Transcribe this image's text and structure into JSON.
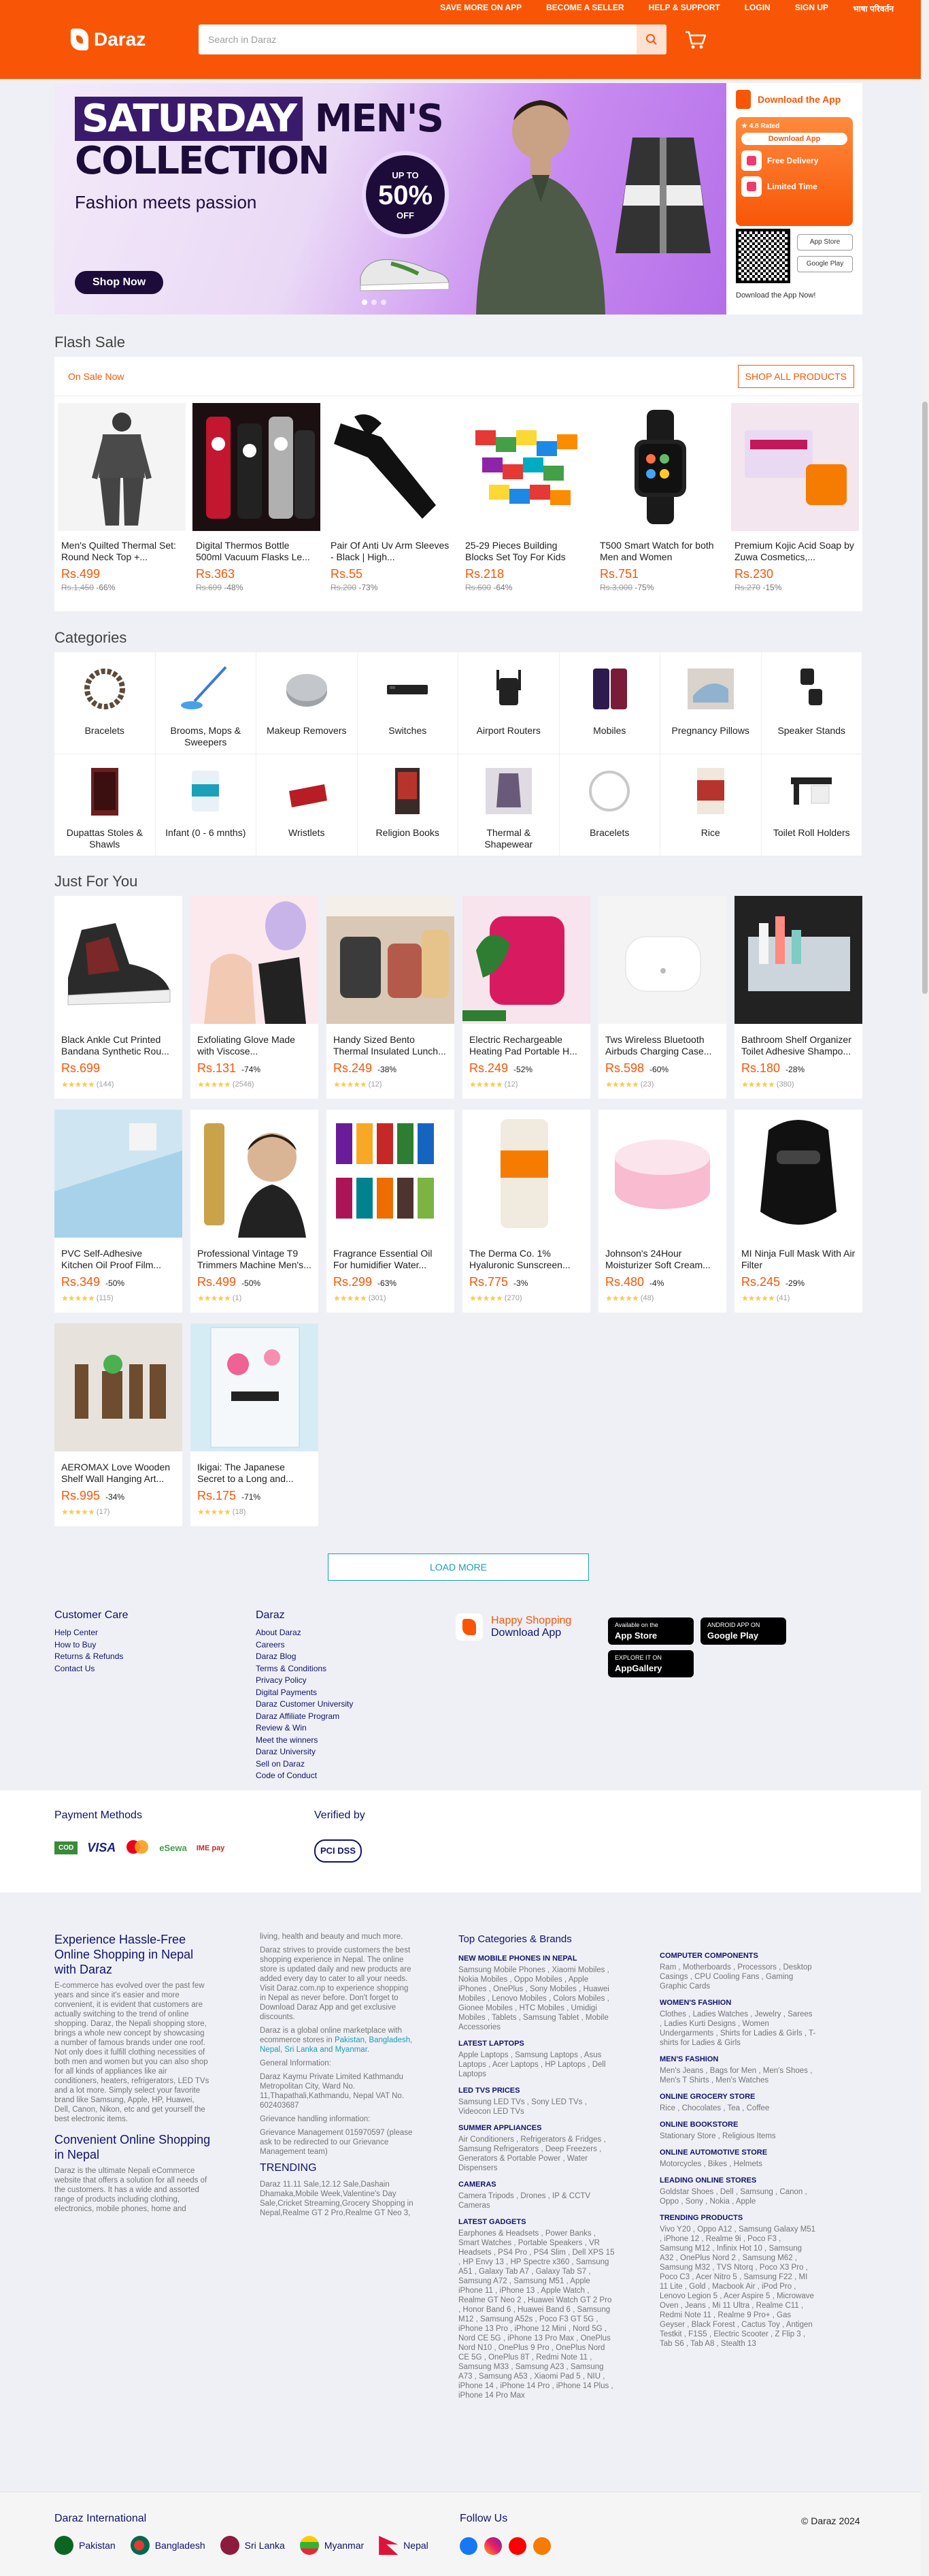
{
  "top_links": [
    "SAVE MORE ON APP",
    "BECOME A SELLER",
    "HELP & SUPPORT",
    "LOGIN",
    "SIGN UP",
    "भाषा परिवर्तन"
  ],
  "logo": "Daraz",
  "search": {
    "placeholder": "Search in Daraz"
  },
  "banner": {
    "title_line1": "SATURDAY",
    "title_line1b": "MEN'S",
    "title_line2": "COLLECTION",
    "subtitle": "Fashion meets passion",
    "button": "Shop Now",
    "badge_top": "UP TO",
    "badge_value": "50%",
    "badge_bottom": "OFF"
  },
  "app_card": {
    "title": "Download the App",
    "rated": "4.8 Rated",
    "download": "Download App",
    "feature1": "Free Delivery",
    "feature2": "Limited Time",
    "store1": "App Store",
    "store2": "Google Play",
    "caption": "Download the App Now!"
  },
  "flash_sale": {
    "title": "Flash Sale",
    "on_sale": "On Sale Now",
    "shop_all": "SHOP ALL PRODUCTS",
    "products": [
      {
        "name": "Men's Quilted Thermal Set: Round Neck Top +...",
        "price": "Rs.499",
        "old": "Rs.1,450",
        "disc": "-66%"
      },
      {
        "name": "Digital Thermos Bottle 500ml Vacuum Flasks Le...",
        "price": "Rs.363",
        "old": "Rs.699",
        "disc": "-48%"
      },
      {
        "name": "Pair Of Anti Uv Arm Sleeves - Black | High...",
        "price": "Rs.55",
        "old": "Rs.200",
        "disc": "-73%"
      },
      {
        "name": "25-29 Pieces Building Blocks Set Toy For Kids",
        "price": "Rs.218",
        "old": "Rs.600",
        "disc": "-64%"
      },
      {
        "name": "T500 Smart Watch for both Men and Women",
        "price": "Rs.751",
        "old": "Rs.3,000",
        "disc": "-75%"
      },
      {
        "name": "Premium Kojic Acid Soap by Zuwa Cosmetics,...",
        "price": "Rs.230",
        "old": "Rs.270",
        "disc": "-15%"
      }
    ]
  },
  "categories": {
    "title": "Categories",
    "items": [
      "Bracelets",
      "Brooms, Mops & Sweepers",
      "Makeup Removers",
      "Switches",
      "Airport Routers",
      "Mobiles",
      "Pregnancy Pillows",
      "Speaker Stands",
      "Dupattas Stoles & Shawls",
      "Infant (0 - 6 mnths)",
      "Wristlets",
      "Religion Books",
      "Thermal & Shapewear",
      "Bracelets",
      "Rice",
      "Toilet Roll Holders"
    ]
  },
  "just_for_you": {
    "title": "Just For You",
    "items": [
      {
        "name": "Black Ankle Cut Printed Bandana Synthetic Rou...",
        "price": "Rs.699",
        "disc": "",
        "reviews": "(144)"
      },
      {
        "name": "Exfoliating Glove Made with Viscose...",
        "price": "Rs.131",
        "disc": "-74%",
        "reviews": "(2546)"
      },
      {
        "name": "Handy Sized Bento Thermal Insulated Lunch...",
        "price": "Rs.249",
        "disc": "-38%",
        "reviews": "(12)"
      },
      {
        "name": "Electric Rechargeable Heating Pad Portable H...",
        "price": "Rs.249",
        "disc": "-52%",
        "reviews": "(12)"
      },
      {
        "name": "Tws Wireless Bluetooth Airbuds Charging Case...",
        "price": "Rs.598",
        "disc": "-60%",
        "reviews": "(23)"
      },
      {
        "name": "Bathroom Shelf Organizer Toilet Adhesive Shampo...",
        "price": "Rs.180",
        "disc": "-28%",
        "reviews": "(380)"
      },
      {
        "name": "PVC Self-Adhesive Kitchen Oil Proof Film...",
        "price": "Rs.349",
        "disc": "-50%",
        "reviews": "(115)"
      },
      {
        "name": "Professional Vintage T9 Trimmers Machine Men's...",
        "price": "Rs.499",
        "disc": "-50%",
        "reviews": "(1)"
      },
      {
        "name": "Fragrance Essential Oil For humidifier Water...",
        "price": "Rs.299",
        "disc": "-63%",
        "reviews": "(301)"
      },
      {
        "name": "The Derma Co. 1% Hyaluronic Sunscreen...",
        "price": "Rs.775",
        "disc": "-3%",
        "reviews": "(270)"
      },
      {
        "name": "Johnson's 24Hour Moisturizer Soft Cream...",
        "price": "Rs.480",
        "disc": "-4%",
        "reviews": "(48)"
      },
      {
        "name": "MI Ninja Full Mask With Air Filter",
        "price": "Rs.245",
        "disc": "-29%",
        "reviews": "(41)"
      },
      {
        "name": "AEROMAX Love Wooden Shelf Wall Hanging Art...",
        "price": "Rs.995",
        "disc": "-34%",
        "reviews": "(17)"
      },
      {
        "name": "Ikigai: The Japanese Secret to a Long and...",
        "price": "Rs.175",
        "disc": "-71%",
        "reviews": "(18)"
      }
    ],
    "load_more": "LOAD MORE"
  },
  "footer": {
    "customer_care": {
      "title": "Customer Care",
      "links": [
        "Help Center",
        "How to Buy",
        "Returns & Refunds",
        "Contact Us"
      ]
    },
    "daraz": {
      "title": "Daraz",
      "links": [
        "About Daraz",
        "Careers",
        "Daraz Blog",
        "Terms & Conditions",
        "Privacy Policy",
        "Digital Payments",
        "Daraz Customer University",
        "Daraz Affiliate Program",
        "Review & Win",
        "Meet the winners",
        "Daraz University",
        "Sell on Daraz",
        "Code of Conduct"
      ]
    },
    "happy_shopping": "Happy Shopping",
    "download_app": "Download App",
    "app_store_small": "Available on the",
    "app_store": "App Store",
    "google_play_small": "ANDROID APP ON",
    "google_play": "Google Play",
    "appgallery_small": "EXPLORE IT ON",
    "appgallery": "AppGallery"
  },
  "payment": {
    "title": "Payment Methods",
    "methods": [
      "COD",
      "VISA",
      "●●",
      "eSewa",
      "IME pay"
    ],
    "verified_title": "Verified by",
    "verified": "PCI DSS"
  },
  "seo": {
    "col1_title": "Experience Hassle-Free Online Shopping in Nepal with Daraz",
    "col1_text": "E-commerce has evolved over the past few years and since it's easier and more convenient, it is evident that customers are actually switching to the trend of online shopping. Daraz, the Nepali shopping store, brings a whole new concept by showcasing a number of famous brands under one roof. Not only does it fulfill clothing necessities of both men and women but you can also shop for all kinds of appliances like air conditioners, heaters, refrigerators, LED TVs and a lot more. Simply select your favorite brand like Samsung, Apple, HP, Huawei, Dell, Canon, Nikon, etc and get yourself the best electronic items.",
    "col1_title2": "Convenient Online Shopping in Nepal",
    "col1_text2": "Daraz is the ultimate Nepali eCommerce website that offers a solution for all needs of the customers. It has a wide and assorted range of products including clothing, electronics, mobile phones, home and",
    "col2_text1": "living, health and beauty and much more.",
    "col2_text2": "Daraz strives to provide customers the best shopping experience in Nepal. The online store is updated daily and new products are added every day to cater to all your needs. Visit Daraz.com.np to experience shopping in Nepal as never before. Don't forget to Download Daraz App and get exclusive discounts.",
    "col2_text3": "Daraz is a global online marketplace with ecommerce stores in",
    "col2_links": "Pakistan, Bangladesh, Nepal, Sri Lanka and Myanmar.",
    "col2_gi": "General Information:",
    "col2_addr": "Daraz Kaymu Private Limited Kathmandu Metropolitan City, Ward No. 11,Thapathali,Kathmandu, Nepal VAT No. 602403687",
    "col2_gh": "Grievance handling information:",
    "col2_gm": "Grievance Management 015970597 (please ask to be redirected to our Grievance Management team)",
    "col2_trending": "TRENDING",
    "col2_trend_text": "Daraz 11.11 Sale,12.12 Sale,Dashain Dhamaka,Mobile Week,Valentine's Day Sale,Cricket Streaming,Grocery Shopping in Nepal,Realme GT 2 Pro,Realme GT Neo 3,",
    "col3_title": "Top Categories & Brands",
    "col3_groups": [
      {
        "h": "NEW MOBILE PHONES IN NEPAL",
        "t": "Samsung Mobile Phones , Xiaomi Mobiles , Nokia Mobiles , Oppo Mobiles , Apple iPhones , OnePlus , Sony Mobiles , Huawei Mobiles , Lenovo Mobiles , Colors Mobiles , Gionee Mobiles , HTC Mobiles , Umidigi Mobiles , Tablets , Samsung Tablet , Mobile Accessories"
      },
      {
        "h": "LATEST LAPTOPS",
        "t": "Apple Laptops , Samsung Laptops , Asus Laptops , Acer Laptops , HP Laptops , Dell Laptops"
      },
      {
        "h": "LED TVS PRICES",
        "t": "Samsung LED TVs , Sony LED TVs , Videocon LED TVs"
      },
      {
        "h": "SUMMER APPLIANCES",
        "t": "Air Conditioners , Refrigerators & Fridges , Samsung Refrigerators , Deep Freezers , Generators & Portable Power , Water Dispensers"
      },
      {
        "h": "CAMERAS",
        "t": "Camera Tripods , Drones , IP & CCTV Cameras"
      },
      {
        "h": "LATEST GADGETS",
        "t": "Earphones & Headsets , Power Banks , Smart Watches , Portable Speakers , VR Headsets , PS4 Pro , PS4 Slim , Dell XPS 15 , HP Envy 13 , HP Spectre x360 , Samsung A51 , Galaxy Tab A7 , Galaxy Tab S7 , Samsung A72 , Samsung M51 , Apple iPhone 11 , iPhone 13 , Apple Watch , Realme GT Neo 2 , Huawei Watch GT 2 Pro , Honor Band 6 , Huawei Band 6 , Samsung M12 , Samsung A52s , Poco F3 GT 5G , iPhone 13 Pro , iPhone 12 Mini , Nord 5G , Nord CE 5G , iPhone 13 Pro Max , OnePlus Nord N10 , OnePlus 9 Pro , OnePlus Nord CE 5G , OnePlus 8T , Redmi Note 11 , Samsung M33 , Samsung A23 , Samsung A73 , Samsung A53 , Xiaomi Pad 5 , NIU , iPhone 14 , iPhone 14 Pro , iPhone 14 Plus , iPhone 14 Pro Max"
      }
    ],
    "col4_groups": [
      {
        "h": "COMPUTER COMPONENTS",
        "t": "Ram , Motherboards , Processors , Desktop Casings , CPU Cooling Fans , Gaming Graphic Cards"
      },
      {
        "h": "WOMEN'S FASHION",
        "t": "Clothes , Ladies Watches , Jewelry , Sarees , Ladies Kurti Designs , Women Undergarments , Shirts for Ladies & Girls , T-shirts for Ladies & Girls"
      },
      {
        "h": "MEN'S FASHION",
        "t": "Men's Jeans , Bags for Men , Men's Shoes , Men's T Shirts , Men's Watches"
      },
      {
        "h": "ONLINE GROCERY STORE",
        "t": "Rice , Chocolates , Tea , Coffee"
      },
      {
        "h": "ONLINE BOOKSTORE",
        "t": "Stationary Store , Religious Items"
      },
      {
        "h": "ONLINE AUTOMOTIVE STORE",
        "t": "Motorcycles , Bikes , Helmets"
      },
      {
        "h": "LEADING ONLINE STORES",
        "t": "Goldstar Shoes , Dell , Samsung , Canon , Oppo , Sony , Nokia , Apple"
      },
      {
        "h": "TRENDING PRODUCTS",
        "t": "Vivo Y20 , Oppo A12 , Samsung Galaxy M51 , iPhone 12 , Realme 9i , Poco F3 , Samsung M12 , Infinix Hot 10 , Samsung A32 , OnePlus Nord 2 , Samsung M62 , Samsung M32 , TVS Ntorq , Poco X3 Pro , Poco C3 , Acer Nitro 5 , Samsung F22 , MI 11 Lite , Gold , Macbook Air , iPod Pro , Lenovo Legion 5 , Acer Aspire 5 , Microwave Oven , Jeans , Mi 11 Ultra , Realme C11 , Redmi Note 11 , Realme 9 Pro+ , Gas Geyser , Black Forest , Cactus Toy , Antigen Testkit , F1S5 , Electric Scooter , Z Flip 3 , Tab S6 , Tab A8 , Stealth 13"
      }
    ]
  },
  "bottom": {
    "international": "Daraz International",
    "countries": [
      "Pakistan",
      "Bangladesh",
      "Sri Lanka",
      "Myanmar",
      "Nepal"
    ],
    "follow": "Follow Us",
    "copyright": "© Daraz 2024"
  }
}
